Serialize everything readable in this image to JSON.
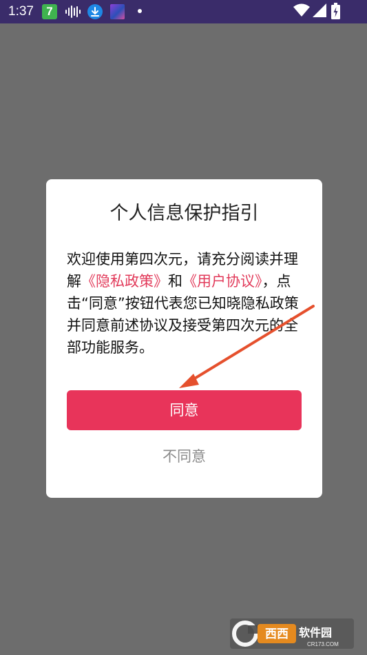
{
  "status_bar": {
    "time": "1:37",
    "app_badge": "7",
    "icons": [
      "app7-icon",
      "sound-wave-icon",
      "download-icon",
      "game-icon",
      "notification-dot-icon",
      "wifi-icon",
      "signal-icon",
      "battery-charging-icon"
    ],
    "background_color": "#3a2c6a"
  },
  "dialog": {
    "title": "个人信息保护指引",
    "body": {
      "part1": "欢迎使用第四次元，请充分阅读并理解",
      "privacy_policy_link": "《隐私政策》",
      "part2": "和",
      "user_agreement_link": "《用户协议》",
      "part3": "，点击“同意”按钮代表您已知晓隐私政策并同意前述协议及接受第四次元的全部功能服务。"
    },
    "agree_label": "同意",
    "disagree_label": "不同意",
    "accent_color": "#e8345a",
    "link_color": "#e23a5a"
  },
  "watermark": {
    "brand": "西西软件园",
    "domain": "CR173.COM"
  },
  "annotation": {
    "type": "arrow",
    "color": "#e5502d",
    "points_to": "agree-button"
  }
}
